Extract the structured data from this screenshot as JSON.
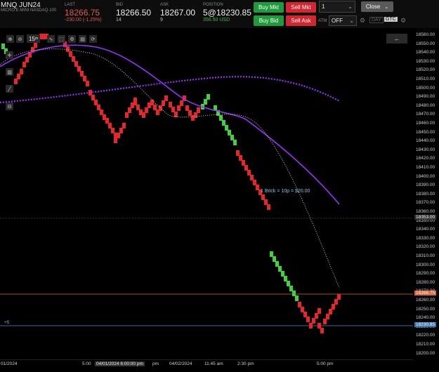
{
  "header": {
    "symbol": "MNQ JUN24",
    "description": "MICRO E-MINI NASDAQ-100",
    "last_label": "LAST",
    "last_value": "18266.75",
    "last_change": "-230.00 (-1.25%)",
    "bid_label": "BID",
    "bid_value": "18266.50",
    "bid_size": "14",
    "ask_label": "ASK",
    "ask_value": "18267.00",
    "ask_size": "9",
    "position_label": "POSITION",
    "position_value": "5@18230.85",
    "position_pnl": "356.50 USD"
  },
  "buttons": {
    "buy_mkt": "Buy Mkt",
    "sell_mkt": "Sell Mkt",
    "buy_bid": "Buy Bid",
    "sell_ask": "Sell Ask",
    "quantity": "1",
    "close": "Close",
    "atm_label": "ATM",
    "atm_value": "OFF",
    "day": "DAY",
    "gtc": "GTC"
  },
  "toolbar": {
    "interval": "15",
    "interval_unit": "m"
  },
  "annotation": {
    "brick": "1 Brick = 10p = $20.00",
    "position_marker": "+5"
  },
  "axis": {
    "ticks": [
      "18560.00",
      "18550.00",
      "18540.00",
      "18530.00",
      "18520.00",
      "18510.00",
      "18500.00",
      "18490.00",
      "18480.00",
      "18470.00",
      "18460.00",
      "18450.00",
      "18440.00",
      "18430.00",
      "18420.00",
      "18410.00",
      "18400.00",
      "18390.00",
      "18380.00",
      "18370.00",
      "18360.00",
      "18350.00",
      "18340.00",
      "18330.00",
      "18320.00",
      "18310.00",
      "18300.00",
      "18290.00",
      "18280.00",
      "18270.00",
      "18260.00",
      "18250.00",
      "18240.00",
      "18230.00",
      "18220.00",
      "18210.00",
      "18200.00"
    ],
    "crosshair_price": "18353.00",
    "last_price_tag": "18266.75",
    "position_price_tag": "18230.85"
  },
  "xaxis": {
    "labels": [
      "01/2024",
      "5:00",
      "pm",
      "04/02/2024",
      "11:45 am",
      "2:30 pm",
      "5:00 pm"
    ],
    "crosshair_time": "04/01/2024 6:00:00 pm"
  },
  "colors": {
    "up": "#3fd23f",
    "down": "#e8252b",
    "ma": "#9b30ff",
    "dots": "#d0d0d0"
  }
}
